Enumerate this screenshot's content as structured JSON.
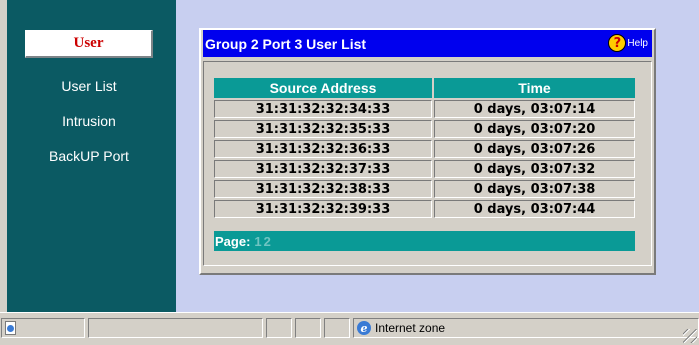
{
  "sidebar": {
    "active_tab": "User",
    "items": [
      {
        "label": "User List"
      },
      {
        "label": "Intrusion"
      },
      {
        "label": "BackUP Port"
      }
    ]
  },
  "panel": {
    "title": "Group 2 Port 3 User List",
    "help_label": "Help",
    "help_icon": "question-mark-icon"
  },
  "table": {
    "columns": [
      "Source Address",
      "Time"
    ],
    "rows": [
      [
        "31:31:32:32:34:33",
        "0 days, 03:07:14"
      ],
      [
        "31:31:32:32:35:33",
        "0 days, 03:07:20"
      ],
      [
        "31:31:32:32:36:33",
        "0 days, 03:07:26"
      ],
      [
        "31:31:32:32:37:33",
        "0 days, 03:07:32"
      ],
      [
        "31:31:32:32:38:33",
        "0 days, 03:07:38"
      ],
      [
        "31:31:32:32:39:33",
        "0 days, 03:07:44"
      ]
    ]
  },
  "pagination": {
    "label": "Page:",
    "pages": [
      "1",
      "2"
    ]
  },
  "statusbar": {
    "zone_label": "Internet zone",
    "zone_icon": "internet-explorer-icon"
  },
  "colors": {
    "nav_bg": "#0b5a63",
    "header_bg": "#0000ee",
    "table_header_bg": "#0a9a96",
    "active_tab_text": "#cc0000",
    "content_bg": "#c8cff0"
  }
}
